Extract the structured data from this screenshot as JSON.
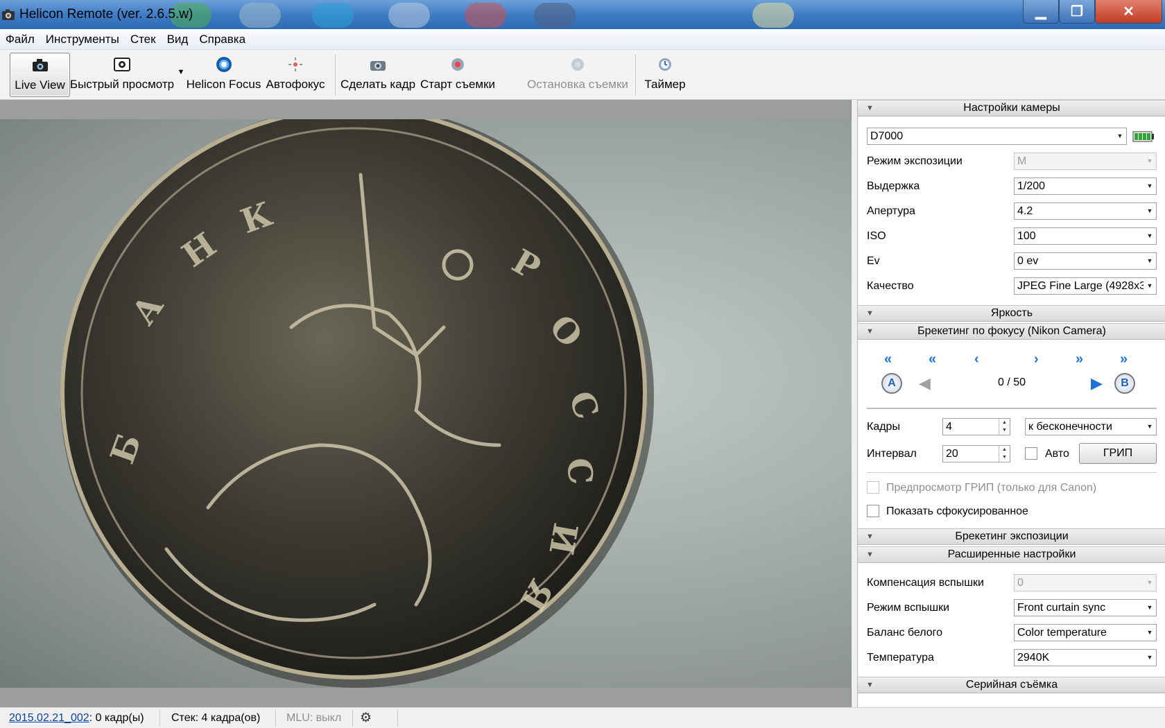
{
  "window": {
    "title": "Helicon Remote (ver. 2.6.5.w)",
    "minimize_glyph": "▁",
    "maximize_glyph": "❐",
    "close_glyph": "✕"
  },
  "menu": [
    "Файл",
    "Инструменты",
    "Стек",
    "Вид",
    "Справка"
  ],
  "toolbar": {
    "live_view": "Live View",
    "quick_view": "Быстрый просмотр",
    "helicon_focus": "Helicon Focus",
    "autofocus": "Автофокус",
    "take_shot": "Сделать кадр",
    "start_shooting": "Старт съемки",
    "stop_shooting": "Остановка съемки",
    "timer": "Таймер"
  },
  "camera_settings": {
    "header": "Настройки камеры",
    "camera_model": "D7000",
    "exposure_mode_label": "Режим экспозиции",
    "exposure_mode_value": "M",
    "shutter_label": "Выдержка",
    "shutter_value": "1/200",
    "aperture_label": "Апертура",
    "aperture_value": "4.2",
    "iso_label": "ISO",
    "iso_value": "100",
    "ev_label": "Ev",
    "ev_value": "0 ev",
    "quality_label": "Качество",
    "quality_value": "JPEG Fine Large (4928x3"
  },
  "brightness": {
    "header": "Яркость"
  },
  "focus_bracketing": {
    "header": "Брекетинг по фокусу (Nikon Camera)",
    "position": "0 / 50",
    "point_a": "A",
    "point_b": "B",
    "frames_label": "Кадры",
    "frames_value": "4",
    "direction_value": "к бесконечности",
    "interval_label": "Интервал",
    "interval_value": "20",
    "auto_label": "Авто",
    "dof_button": "ГРИП",
    "dof_preview_label": "Предпросмотр ГРИП (только для Canon)",
    "show_focused_label": "Показать сфокусированное"
  },
  "exposure_bracketing": {
    "header": "Брекетинг экспозиции"
  },
  "advanced": {
    "header": "Расширенные настройки",
    "flash_comp_label": "Компенсация вспышки",
    "flash_comp_value": "0",
    "flash_mode_label": "Режим вспышки",
    "flash_mode_value": "Front curtain sync",
    "wb_label": "Баланс белого",
    "wb_value": "Color temperature",
    "temp_label": "Температура",
    "temp_value": "2940K"
  },
  "burst": {
    "header": "Серийная съёмка"
  },
  "status": {
    "session_link": "2015.02.21_002",
    "session_frames": ": 0 кадр(ы)",
    "stack": "Стек: 4 кадра(ов)",
    "mlu": "MLU: выкл"
  },
  "colors": {
    "titlebar": "#3f7cc4",
    "nav_arrow": "#1f6fd6",
    "battery": "#2fa82f",
    "link": "#0b3ea8"
  }
}
